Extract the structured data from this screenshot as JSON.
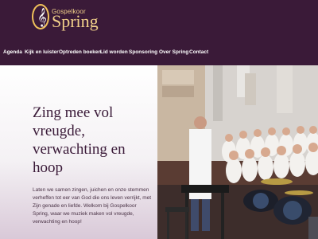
{
  "logo": {
    "small_text": "Gospelkoor",
    "main_text": "Spring",
    "clef_glyph": "𝄞"
  },
  "nav": {
    "items": [
      {
        "label": "Agenda"
      },
      {
        "label": "Kijk en luister"
      },
      {
        "label": "Optreden boeken"
      },
      {
        "label": "Lid worden"
      },
      {
        "label": "Sponsoring"
      },
      {
        "label": "Over Spring"
      },
      {
        "label": "Contact"
      }
    ]
  },
  "hero": {
    "title": "Zing mee vol vreugde, verwachting en hoop",
    "paragraph": "Laten we samen zingen, juichen en onze stemmen verheffen tot eer van God die ons leven verrijkt, met Zijn genade en liefde. Welkom bij Gospelkoor Spring, waar we muziek maken vol vreugde, verwachting en hoop!"
  },
  "colors": {
    "header_bg": "#3a1a38",
    "accent_gold": "#f2d18a",
    "title_color": "#3a1a38"
  }
}
